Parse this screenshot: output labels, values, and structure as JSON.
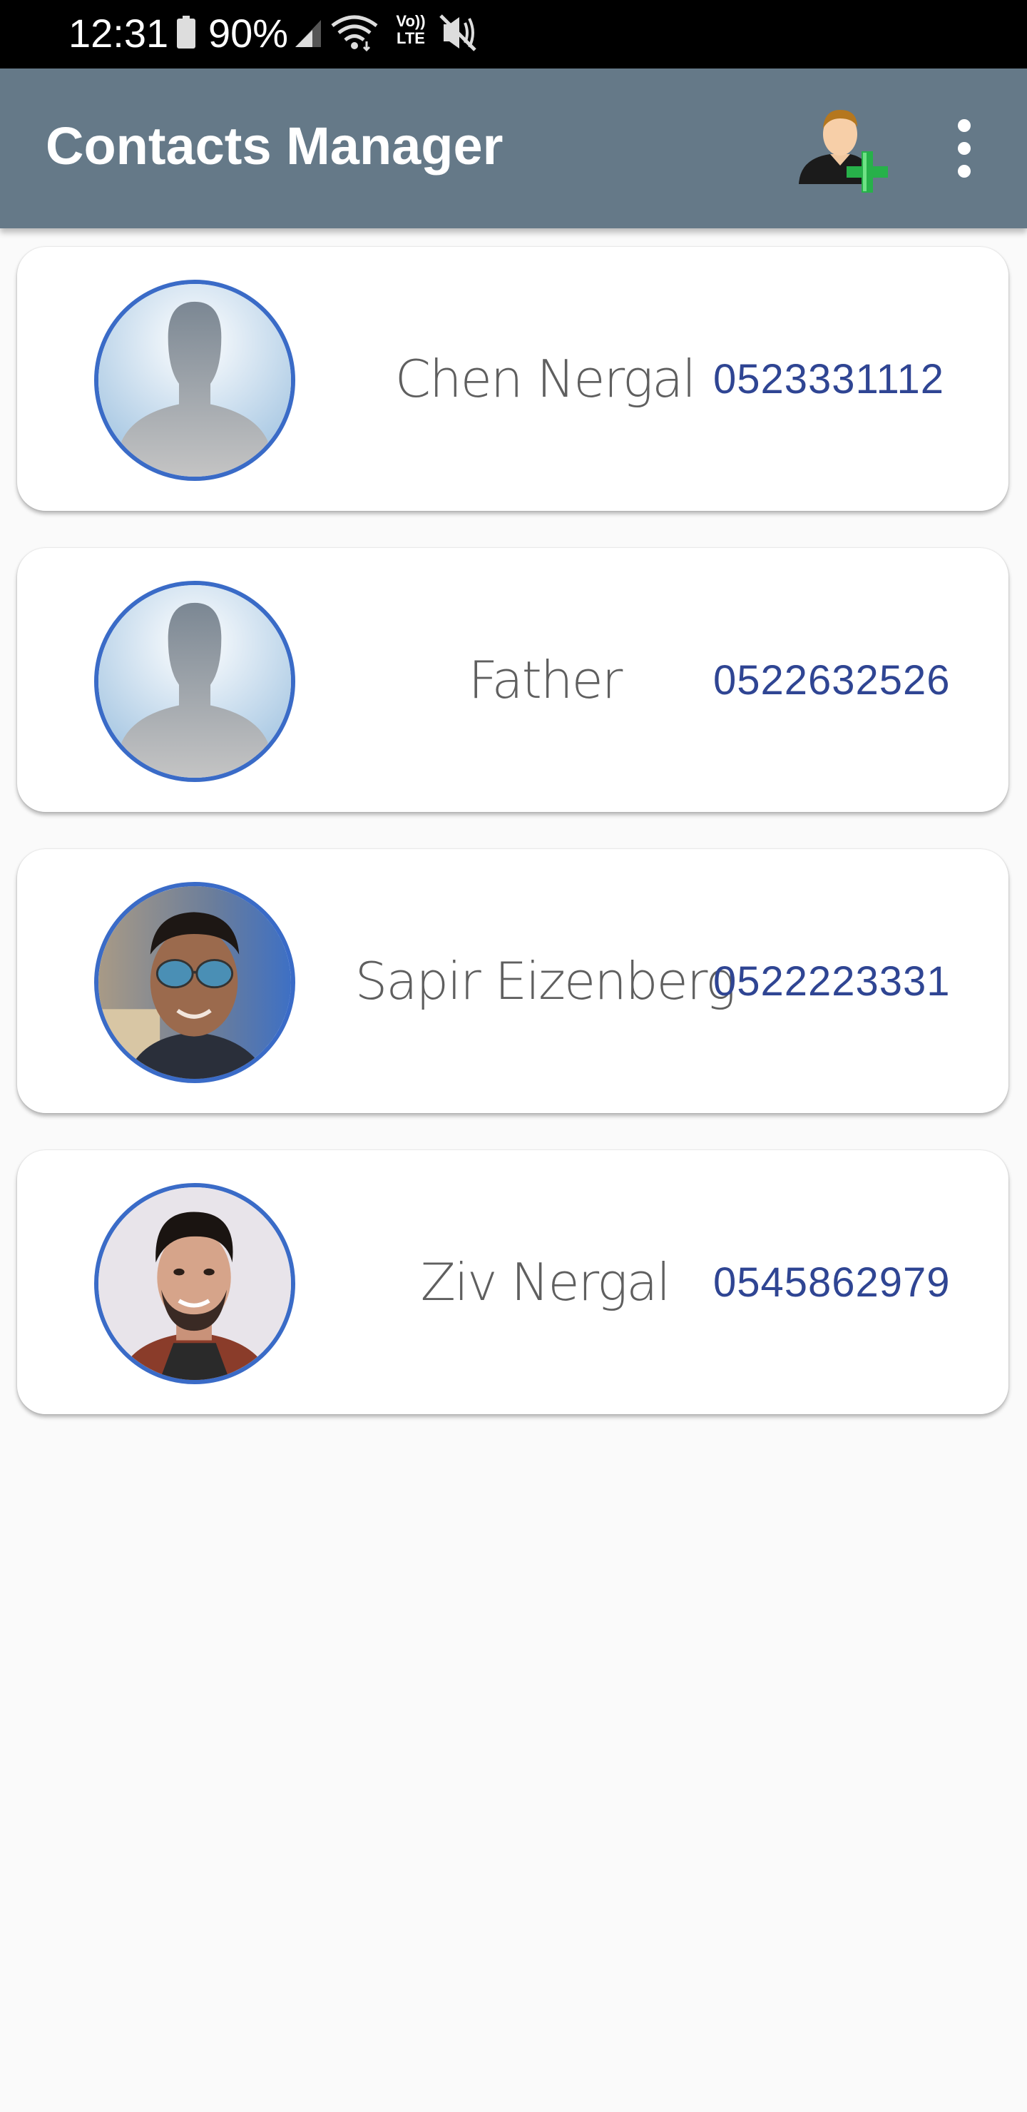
{
  "status_bar": {
    "time": "12:31",
    "battery_percent": "90%",
    "icons": [
      "battery-icon",
      "signal-icon",
      "wifi-icon",
      "volte-icon",
      "mute-icon"
    ],
    "volte_text_top": "Vo))",
    "volte_text_bottom": "LTE"
  },
  "app_bar": {
    "title": "Contacts Manager",
    "background_color": "#657988",
    "actions": [
      "add-contact-icon",
      "more-vert-icon"
    ]
  },
  "contacts": [
    {
      "name": "Chen Nergal",
      "phone": "0523331112",
      "avatar": "default-avatar-icon"
    },
    {
      "name": "Father",
      "phone": "0522632526",
      "avatar": "default-avatar-icon"
    },
    {
      "name": "Sapir Eizenberg",
      "phone": "0522223331",
      "avatar": "photo-avatar-sunglasses"
    },
    {
      "name": "Ziv Nergal",
      "phone": "0545862979",
      "avatar": "photo-avatar-smiling"
    }
  ],
  "colors": {
    "phone_text": "#2f4593",
    "avatar_ring": "#3a6bc7",
    "name_text": "#5f5f5f"
  }
}
